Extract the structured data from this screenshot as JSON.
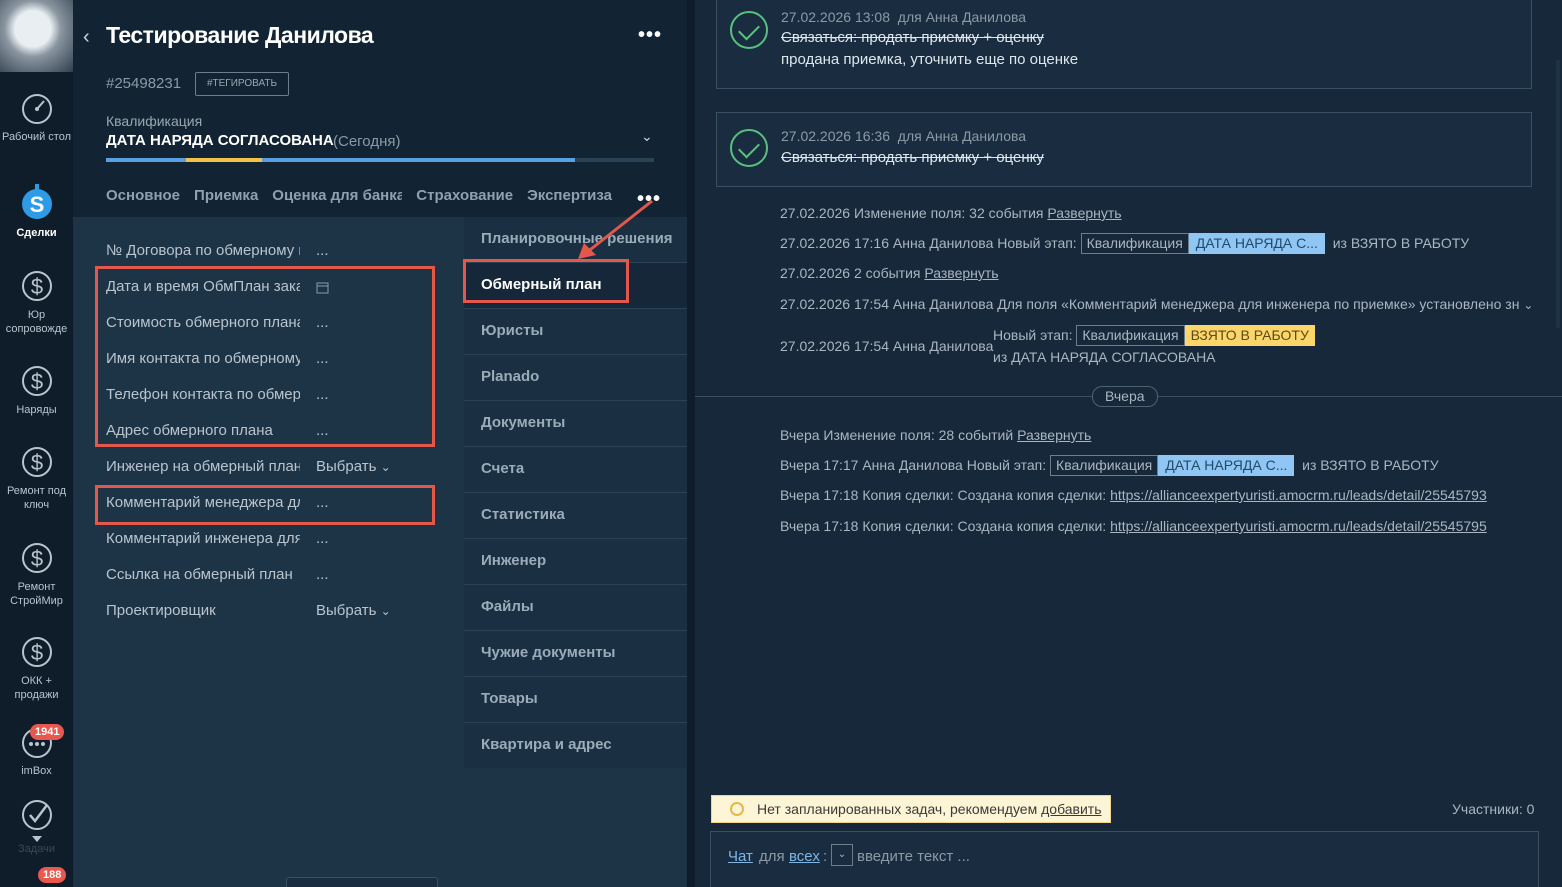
{
  "nav": {
    "items": [
      {
        "label": "Рабочий стол",
        "icon": "dashboard-icon"
      },
      {
        "label": "Сделки",
        "icon": "deals-icon",
        "active": true
      },
      {
        "label": "Юр сопровожде",
        "icon": "dollar-icon"
      },
      {
        "label": "Наряды",
        "icon": "dollar-icon"
      },
      {
        "label": "Ремонт под ключ",
        "icon": "dollar-icon"
      },
      {
        "label": "Ремонт СтройМир",
        "icon": "dollar-icon"
      },
      {
        "label": "ОКК + продажи",
        "icon": "dollar-icon"
      },
      {
        "label": "imBox",
        "icon": "chat-icon",
        "badge": "1941"
      },
      {
        "label": "Задачи",
        "icon": "check-icon"
      },
      {
        "label": "",
        "icon": "bottom-icon",
        "badge": "188"
      }
    ]
  },
  "lead": {
    "title": "Тестирование Данилова",
    "id": "#25498231",
    "tag_button": "#ТЕГИРОВАТЬ",
    "pipeline_label": "Квалификация",
    "status": "ДАТА НАРЯДА СОГЛАСОВАНА",
    "status_when": "(Сегодня)",
    "tabs": [
      "Основное",
      "Приемка",
      "Оценка для банка",
      "Страхование",
      "Экспертиза"
    ],
    "fields": [
      {
        "label": "№ Договора по обмерному плану",
        "value": "..."
      },
      {
        "label": "Дата и время ОбмПлан заказ",
        "value": "calendar"
      },
      {
        "label": "Стоимость обмерного плана",
        "value": "..."
      },
      {
        "label": "Имя контакта по обмерному плану",
        "value": "..."
      },
      {
        "label": "Телефон контакта по обмерному плану",
        "value": "..."
      },
      {
        "label": "Адрес обмерного плана",
        "value": "..."
      },
      {
        "label": "Инженер на обмерный план",
        "value": "Выбрать"
      },
      {
        "label": "Комментарий менеджера для инженера",
        "value": "..."
      },
      {
        "label": "Комментарий инженера для менеджера",
        "value": "..."
      },
      {
        "label": "Ссылка на обмерный план",
        "value": "..."
      },
      {
        "label": "Проектировщик",
        "value": "Выбрать"
      }
    ],
    "tab_menu": [
      "Планировочные решения",
      "Обмерный план",
      "Юристы",
      "Planado",
      "Документы",
      "Счета",
      "Статистика",
      "Инженер",
      "Файлы",
      "Чужие документы",
      "Товары",
      "Квартира и адрес"
    ],
    "tab_menu_active": "Обмерный план",
    "progress_colors": [
      "#5aa0e0",
      "#f1c24a",
      "#5aa0e0"
    ]
  },
  "feed": {
    "tasks": [
      {
        "date": "27.02.2026 13:08",
        "for": "для Анна Данилова",
        "text": "Связаться: продать приемку + оценку",
        "result": "продана приемка, уточнить еще по оценке"
      },
      {
        "date": "27.02.2026 16:36",
        "for": "для Анна Данилова",
        "text": "Связаться: продать приемку + оценку",
        "result": ""
      }
    ],
    "events_today": [
      {
        "text": "27.02.2026 Изменение поля: 32 события ",
        "link": "Развернуть"
      },
      {
        "text": "27.02.2026 17:16 Анна Данилова Новый этап: ",
        "chip": "Квалификация",
        "blue": "ДАТА НАРЯДА С...",
        "tail": "из ВЗЯТО В РАБОТУ"
      },
      {
        "text": "27.02.2026 2 события ",
        "link": "Развернуть"
      },
      {
        "text": "27.02.2026 17:54 Анна Данилова Для поля «Комментарий менеджера для инженера по приемке» установлено зн"
      },
      {
        "text": "27.02.2026 17:54 Анна Данилова",
        "new_stage": "Новый этап:",
        "chip": "Квалификация",
        "yellow": "ВЗЯТО В РАБОТУ",
        "from": "из ДАТА НАРЯДА СОГЛАСОВАНА"
      }
    ],
    "day_label": "Вчера",
    "events_yesterday": [
      {
        "text": "Вчера Изменение поля: 28 событий ",
        "link": "Развернуть"
      },
      {
        "text": "Вчера 17:17 Анна Данилова Новый этап: ",
        "chip": "Квалификация",
        "blue": "ДАТА НАРЯДА С...",
        "tail": "из ВЗЯТО В РАБОТУ"
      },
      {
        "text": "Вчера 17:18 Копия сделки: Создана копия сделки: ",
        "link": "https://allianceexpertyuristi.amocrm.ru/leads/detail/25545793"
      },
      {
        "text": "Вчера 17:18 Копия сделки: Создана копия сделки: ",
        "link": "https://allianceexpertyuristi.amocrm.ru/leads/detail/25545795"
      }
    ],
    "notice_text": "Нет запланированных задач, рекомендуем ",
    "notice_link": "добавить",
    "participants": "Участники: 0",
    "composer": {
      "chat": "Чат",
      "for": "для",
      "all": "всех",
      "colon": ":",
      "placeholder": "введите текст ..."
    }
  }
}
